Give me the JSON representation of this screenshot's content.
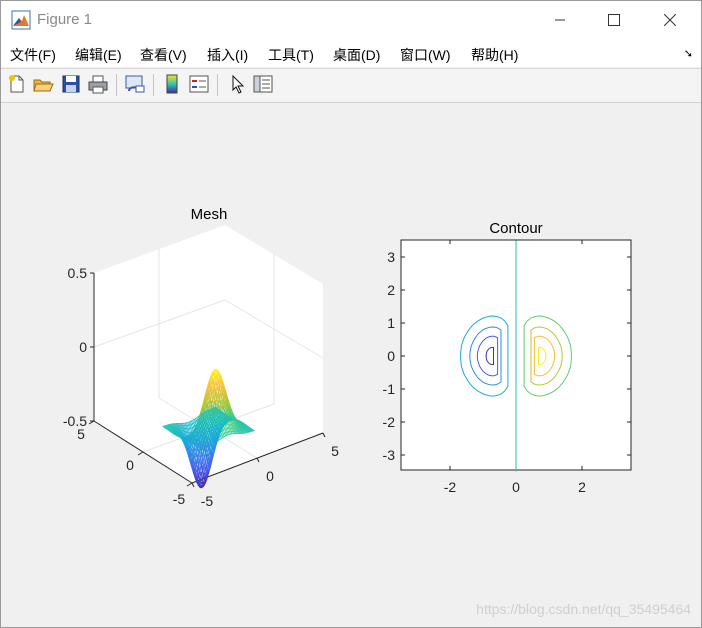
{
  "window": {
    "title": "Figure 1"
  },
  "menu": [
    {
      "label": "文件(F)"
    },
    {
      "label": "编辑(E)"
    },
    {
      "label": "查看(V)"
    },
    {
      "label": "插入(I)"
    },
    {
      "label": "工具(T)"
    },
    {
      "label": "桌面(D)"
    },
    {
      "label": "窗口(W)"
    },
    {
      "label": "帮助(H)"
    }
  ],
  "toolbar_icons": [
    "new-figure-icon",
    "open-file-icon",
    "save-icon",
    "print-icon",
    "link-plot-icon",
    "colorbar-icon",
    "legend-icon",
    "pointer-icon",
    "property-editor-icon"
  ],
  "chart_data": [
    {
      "type": "mesh",
      "title": "Mesh",
      "x_ticks": [
        "-5",
        "0",
        "5"
      ],
      "y_ticks": [
        "-5",
        "0",
        "5"
      ],
      "z_ticks": [
        "-0.5",
        "0",
        "0.5"
      ],
      "zlim": [
        -0.5,
        0.5
      ],
      "grid": true
    },
    {
      "type": "contour",
      "title": "Contour",
      "x_ticks": [
        "-2",
        "0",
        "2"
      ],
      "y_ticks": [
        "-3",
        "-2",
        "-1",
        "0",
        "1",
        "2",
        "3"
      ],
      "xlim": [
        -3.5,
        3.5
      ],
      "ylim": [
        -3.5,
        3.5
      ]
    }
  ],
  "watermark": "https://blog.csdn.net/qq_35495464"
}
